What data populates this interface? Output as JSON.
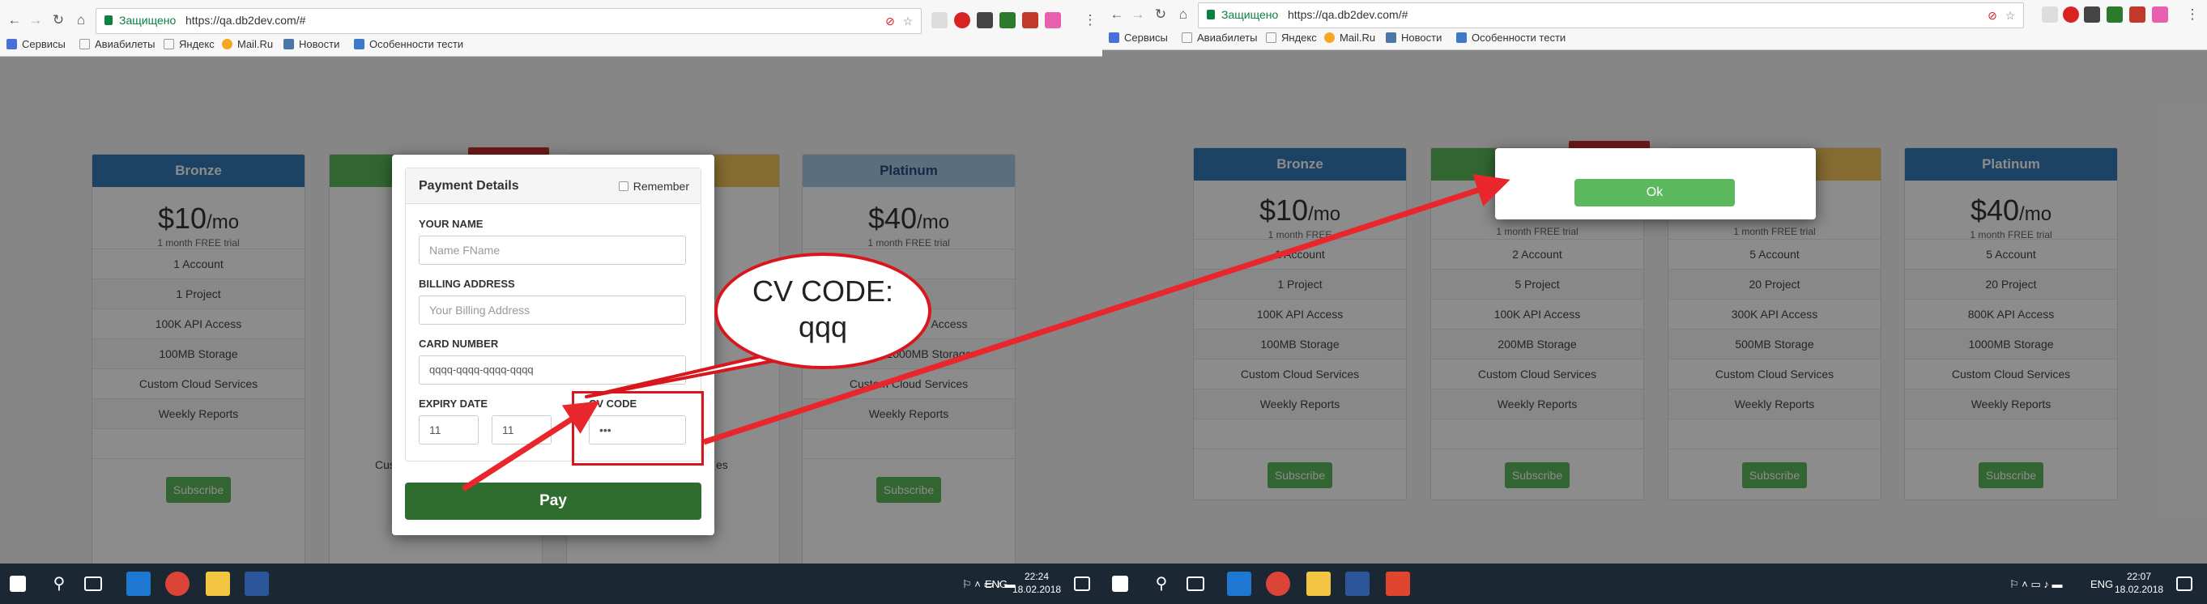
{
  "left": {
    "browser": {
      "secure_label": "Защищено",
      "url": "https://qa.db2dev.com/#",
      "bookmarks": [
        "Сервисы",
        "Авиабилеты",
        "Яндекс",
        "Mail.Ru",
        "Новости",
        "Особенности тести"
      ]
    },
    "plans": [
      {
        "name": "Bronze",
        "price": "$10",
        "per": "/mo",
        "trial": "1 month FREE trial",
        "features": [
          "1 Account",
          "1 Project",
          "100K API Access",
          "100MB Storage",
          "Custom Cloud Services",
          "Weekly Reports"
        ],
        "button": "Subscribe",
        "color": "#337ab7"
      },
      {
        "name": "",
        "price": "",
        "per": "",
        "trial": "",
        "features": [],
        "button": "",
        "color": "#5cb85c"
      },
      {
        "name": "",
        "price": "",
        "per": "",
        "trial": "",
        "features": [],
        "button": "",
        "color": "#f0c45a"
      },
      {
        "name": "Platinum",
        "price": "$40",
        "per": "/mo",
        "trial": "1 month FREE trial",
        "features": [
          "",
          "",
          "800K API Access",
          "1000MB Storage",
          "Custom Cloud Services",
          "Weekly Reports"
        ],
        "button": "Subscribe",
        "color": "#a6c8e6"
      }
    ],
    "partial_text": {
      "custom_cloud_left": "Cus",
      "custom_cloud_mid": "es",
      "api_access_right": "Access",
      "storage_right": "1000MB Storage"
    },
    "modal": {
      "title": "Payment Details",
      "remember": "Remember",
      "name_label": "YOUR NAME",
      "name_placeholder": "Name FName",
      "address_label": "BILLING ADDRESS",
      "address_placeholder": "Your Billing Address",
      "card_label": "CARD NUMBER",
      "card_value": "qqqq-qqqq-qqqq-qqqq",
      "expiry_label": "EXPIRY DATE",
      "expiry_month": "11",
      "expiry_year": "11",
      "cv_label": "CV CODE",
      "cv_value": "•••",
      "pay_label": "Pay"
    },
    "callout": {
      "line1": "CV CODE:",
      "line2": "qqq"
    },
    "taskbar": {
      "lang": "ENG",
      "time": "22:24",
      "date": "18.02.2018"
    }
  },
  "right": {
    "browser": {
      "secure_label": "Защищено",
      "url": "https://qa.db2dev.com/#",
      "bookmarks": [
        "Сервисы",
        "Авиабилеты",
        "Яндекс",
        "Mail.Ru",
        "Новости",
        "Особенности тести"
      ]
    },
    "plans": [
      {
        "name": "Bronze",
        "price": "$10",
        "per": "/mo",
        "trial": "1 month FREE",
        "features": [
          "1 Account",
          "1 Project",
          "100K API Access",
          "100MB Storage",
          "Custom Cloud Services",
          "Weekly Reports"
        ],
        "button": "Subscribe",
        "color": "#337ab7"
      },
      {
        "name": "",
        "price": "",
        "per": "",
        "trial": "1 month FREE trial",
        "features": [
          "2 Account",
          "5 Project",
          "100K API Access",
          "200MB Storage",
          "Custom Cloud Services",
          "Weekly Reports"
        ],
        "button": "Subscribe",
        "color": "#5cb85c"
      },
      {
        "name": "",
        "price": "",
        "per": "",
        "trial": "1 month FREE trial",
        "features": [
          "5 Account",
          "20 Project",
          "300K API Access",
          "500MB Storage",
          "Custom Cloud Services",
          "Weekly Reports"
        ],
        "button": "Subscribe",
        "color": "#f0c45a"
      },
      {
        "name": "Platinum",
        "price": "$40",
        "per": "/mo",
        "trial": "1 month FREE trial",
        "features": [
          "5 Account",
          "20 Project",
          "800K API Access",
          "1000MB Storage",
          "Custom Cloud Services",
          "Weekly Reports"
        ],
        "button": "Subscribe",
        "color": "#337ab7"
      }
    ],
    "alert": {
      "ok_label": "Ok"
    },
    "taskbar": {
      "lang": "ENG",
      "time": "22:07",
      "date": "18.02.2018"
    }
  },
  "colors": {
    "accent_red": "#d9161d",
    "pay_green": "#2e6d2e",
    "button_green": "#5cb85c",
    "taskbar": "#1b2733"
  }
}
